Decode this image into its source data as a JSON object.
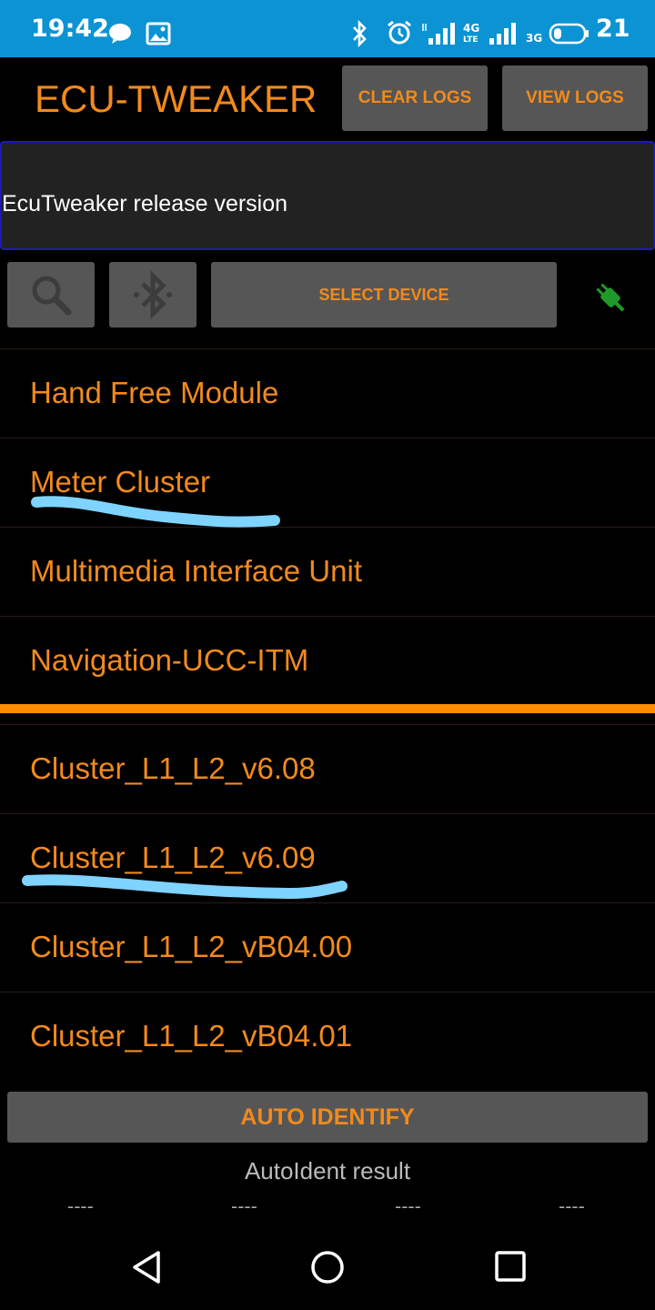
{
  "status_bar": {
    "time": "19:42",
    "network_4g": "4G",
    "network_lte": "LTE",
    "network_3g": "3G",
    "battery": "21",
    "icons": [
      "chat-icon",
      "image-icon",
      "bluetooth-icon",
      "alarm-icon",
      "signal-icon",
      "signal-icon",
      "battery-icon"
    ]
  },
  "header": {
    "title": "ECU-TWEAKER",
    "clear_logs": "CLEAR LOGS",
    "view_logs": "VIEW LOGS"
  },
  "banner": {
    "text": "EcuTweaker release version"
  },
  "toolbar": {
    "search_icon": "search-icon",
    "bluetooth_icon": "bluetooth-icon",
    "select_device": "SELECT DEVICE",
    "connection_icon": "plug-icon",
    "connection_color": "#1f9a2a"
  },
  "ecu_list": [
    "Hand Free Module",
    "Meter Cluster",
    "Multimedia Interface Unit",
    "Navigation-UCC-ITM"
  ],
  "version_list": [
    "Cluster_L1_L2_v6.08",
    "Cluster_L1_L2_v6.09",
    "Cluster_L1_L2_vB04.00",
    "Cluster_L1_L2_vB04.01"
  ],
  "auto_identify": {
    "button": "AUTO IDENTIFY",
    "result_label": "AutoIdent result",
    "results": [
      "----",
      "----",
      "----",
      "----"
    ]
  },
  "colors": {
    "accent": "#f28a1d",
    "statusbar": "#0b93d4",
    "highlight_underline": "#7fd3ff",
    "divider": "#ff8c00"
  }
}
